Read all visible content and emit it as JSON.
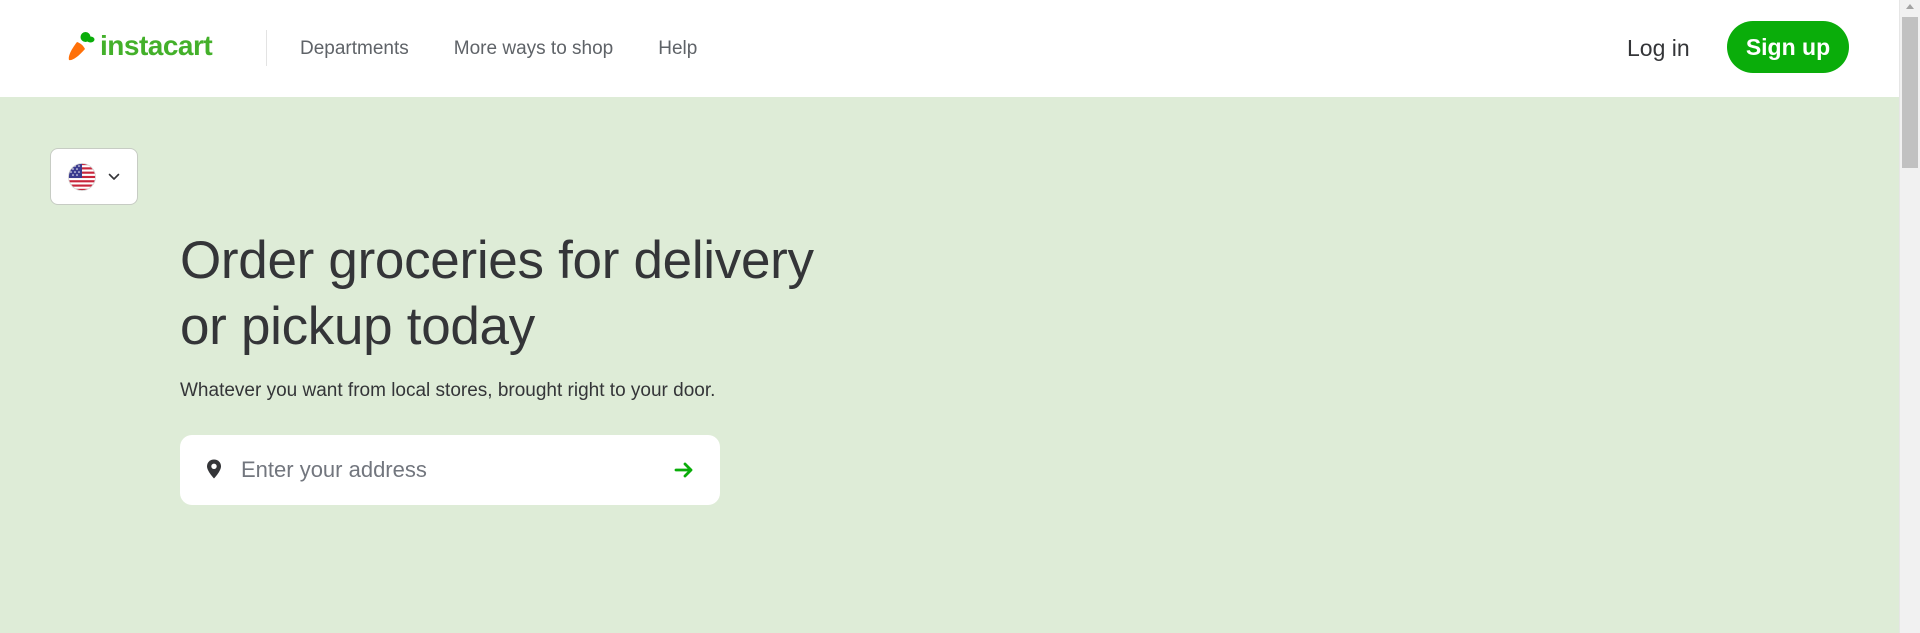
{
  "brand": {
    "name": "instacart",
    "color": "#43b02a",
    "carrot_orange": "#ff7009",
    "carrot_green": "#0aad0a"
  },
  "nav": {
    "items": [
      {
        "label": "Departments"
      },
      {
        "label": "More ways to shop"
      },
      {
        "label": "Help"
      }
    ]
  },
  "auth": {
    "login_label": "Log in",
    "signup_label": "Sign up",
    "signup_color": "#0aad0a"
  },
  "hero": {
    "background": "#deecd7",
    "country": {
      "flag_icon": "us-flag-icon",
      "dropdown_icon": "chevron-down-icon"
    },
    "headline_line1": "Order groceries for delivery",
    "headline_line2": "or pickup today",
    "subtext": "Whatever you want from local stores, brought right to your door.",
    "address": {
      "placeholder": "Enter your address",
      "value": "",
      "leading_icon": "map-pin-icon",
      "submit_icon": "arrow-right-icon"
    }
  },
  "colors": {
    "text": "#343538",
    "nav_text": "#5f6368",
    "accent": "#0aad0a"
  }
}
